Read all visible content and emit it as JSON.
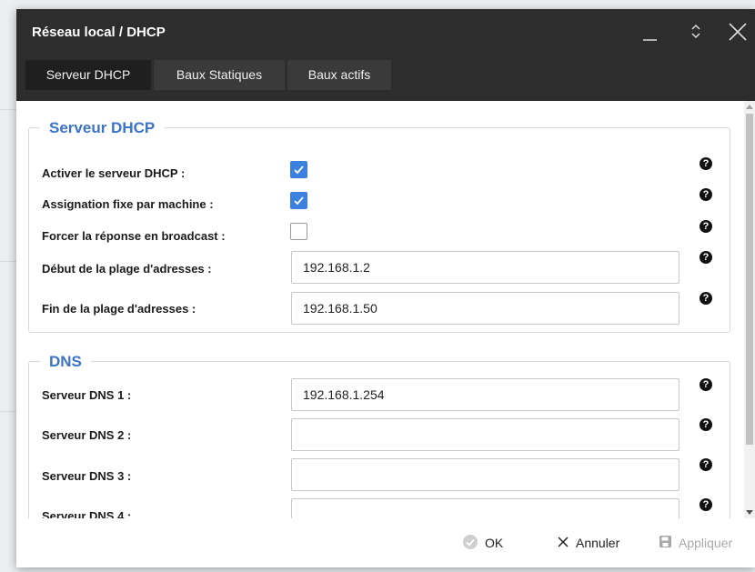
{
  "window": {
    "title": "Réseau local / DHCP",
    "controls": [
      "minimize-icon",
      "restore-icon",
      "close-icon"
    ]
  },
  "tabs": [
    {
      "label": "Serveur DHCP",
      "active": true
    },
    {
      "label": "Baux Statiques",
      "active": false
    },
    {
      "label": "Baux actifs",
      "active": false
    }
  ],
  "dhcp_section": {
    "legend": "Serveur DHCP",
    "enable_label": "Activer le serveur DHCP :",
    "enable_checked": true,
    "fixed_assignment_label": "Assignation fixe par machine :",
    "fixed_assignment_checked": true,
    "broadcast_label": "Forcer la réponse en broadcast :",
    "broadcast_checked": false,
    "range_start_label": "Début de la plage d'adresses :",
    "range_start_value": "192.168.1.2",
    "range_end_label": "Fin de la plage d'adresses :",
    "range_end_value": "192.168.1.50"
  },
  "dns_section": {
    "legend": "DNS",
    "dns1_label": "Serveur DNS 1 :",
    "dns1_value": "192.168.1.254",
    "dns2_label": "Serveur DNS 2 :",
    "dns2_value": "",
    "dns3_label": "Serveur DNS 3 :",
    "dns3_value": "",
    "dns4_label": "Serveur DNS 4 :",
    "dns4_value": ""
  },
  "help_icon": "?",
  "footer": {
    "ok_label": "OK",
    "cancel_label": "Annuler",
    "apply_label": "Appliquer"
  },
  "colors": {
    "titlebar": "#2d2d2d",
    "accent": "#3c80e0",
    "legend": "#3b73c9",
    "disabled": "#a8a8a8"
  }
}
